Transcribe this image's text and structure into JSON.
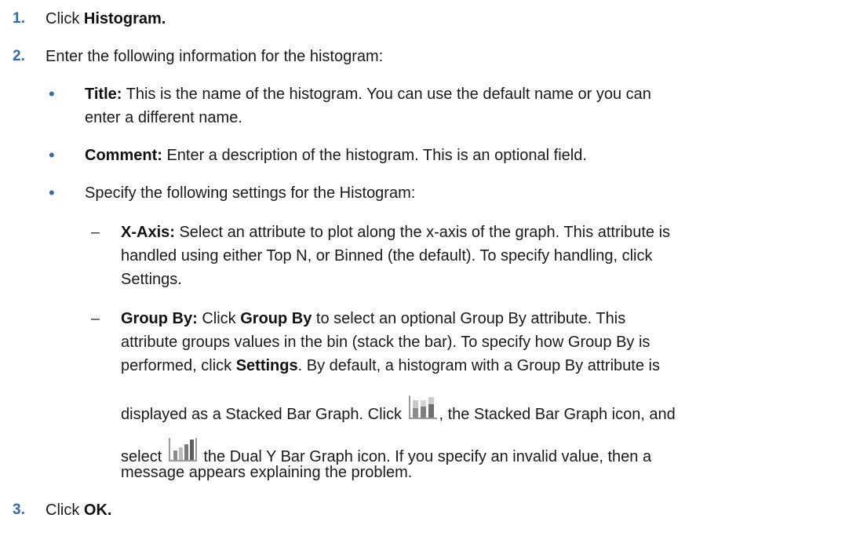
{
  "steps": [
    {
      "number": "1.",
      "pre": "Click ",
      "bold": "Histogram."
    },
    {
      "number": "2.",
      "text": "Enter the following information for the histogram:"
    },
    {
      "number": "3.",
      "pre": "Click ",
      "bold": "OK."
    }
  ],
  "bullets": {
    "title": {
      "label": "Title:",
      "line1": " This is the name of the histogram. You can use the default name or you can",
      "line2": "enter a different name."
    },
    "comment": {
      "label": "Comment:",
      "text": " Enter a description of the histogram. This is an optional field."
    },
    "settings": {
      "text": "Specify the following settings for the Histogram:"
    }
  },
  "subitems": {
    "xaxis": {
      "label": "X-Axis:",
      "line1": " Select an attribute to plot along the x-axis of the graph. This attribute is",
      "line2": "handled using either Top N, or Binned (the default). To specify handling, click",
      "line3": "Settings."
    },
    "groupby": {
      "label": "Group By:",
      "line1_a": " Click ",
      "line1_b": "Group By",
      "line1_c": " to select an optional Group By attribute. This",
      "line2": "attribute groups values in the bin (stack the bar). To specify how Group By is",
      "line3_a": "performed, click ",
      "line3_b": "Settings",
      "line3_c": ". By default, a histogram with a Group By attribute is",
      "line4_a": "displayed as a Stacked Bar Graph. Click ",
      "line4_b": ", the Stacked Bar Graph icon, and",
      "line5_a": "select ",
      "line5_b": " the Dual Y Bar Graph icon. If you specify an invalid value, then a",
      "line6": "message appears explaining the problem."
    }
  },
  "glyphs": {
    "bullet": "•",
    "dash": "–"
  },
  "icons": {
    "stacked": "stacked-bar-graph-icon",
    "dual": "dual-y-bar-graph-icon"
  },
  "colors": {
    "accent": "#2f6bb5",
    "text": "#1a1a1a"
  }
}
